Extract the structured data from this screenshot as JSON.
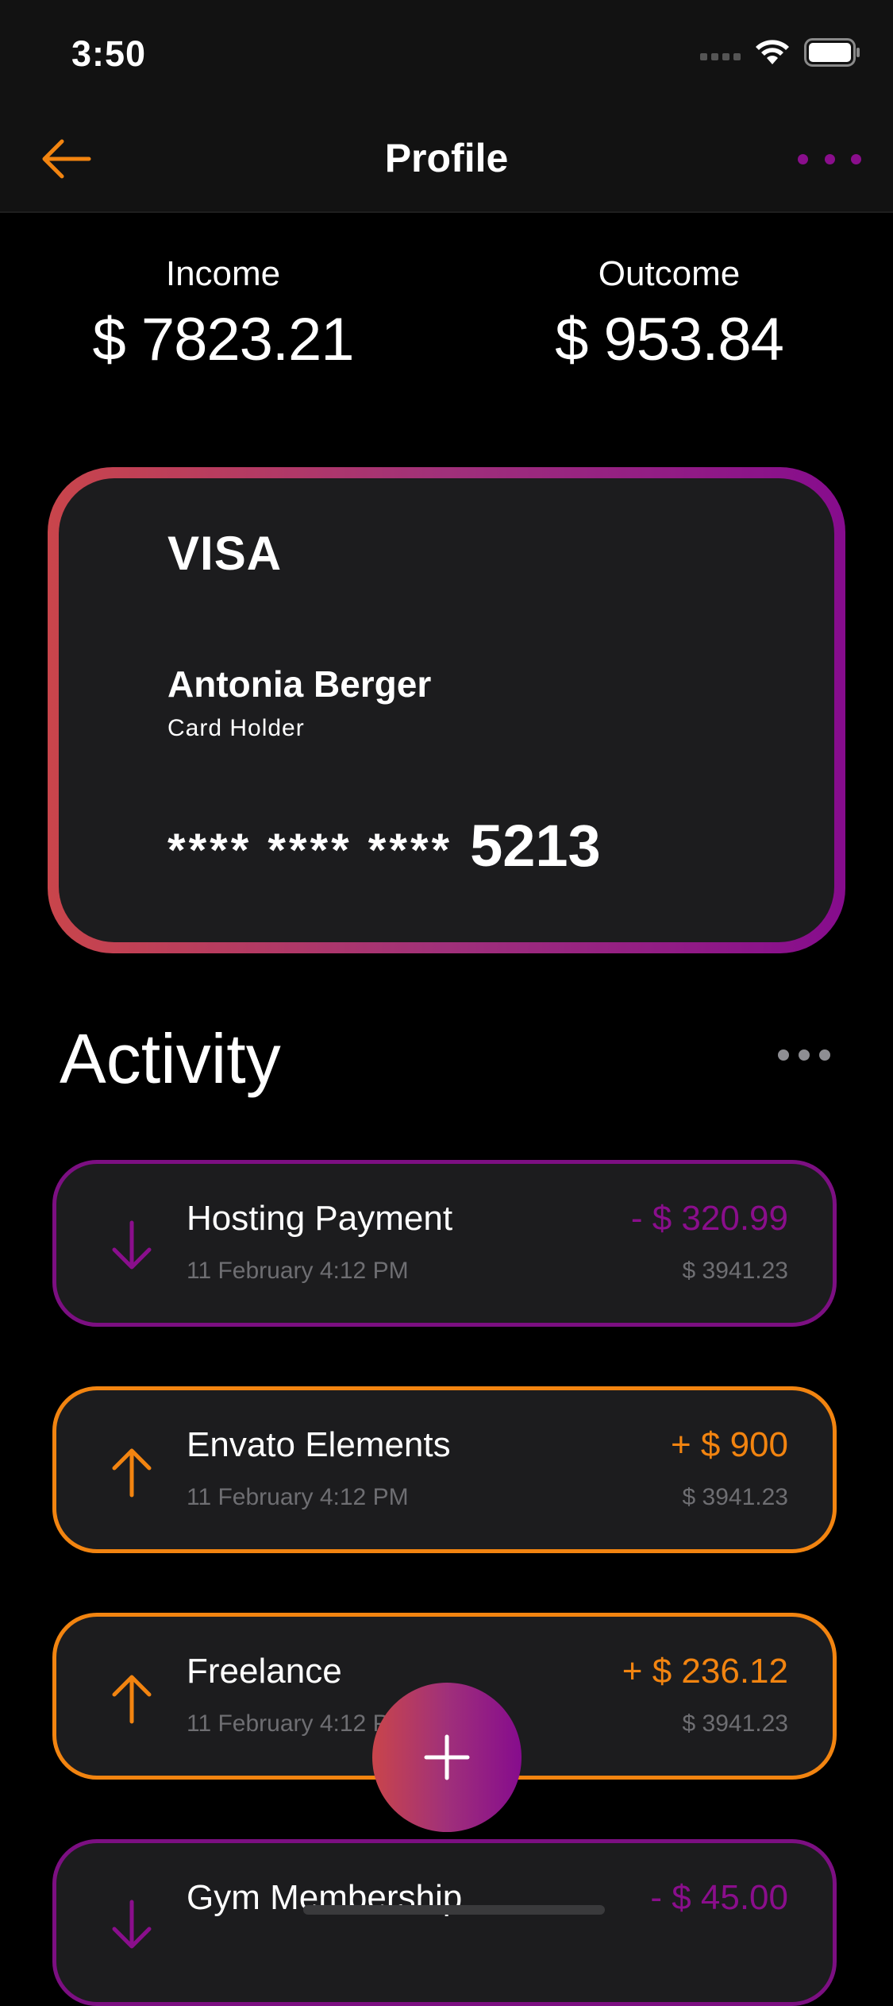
{
  "status_bar": {
    "time": "3:50"
  },
  "nav": {
    "title": "Profile"
  },
  "summary": {
    "income_label": "Income",
    "income_value": "$ 7823.21",
    "outcome_label": "Outcome",
    "outcome_value": "$ 953.84"
  },
  "card": {
    "brand": "VISA",
    "holder_name": "Antonia Berger",
    "holder_label": "Card Holder",
    "number_mask": "**** **** ****",
    "number_last": "5213"
  },
  "activity": {
    "title": "Activity",
    "items": [
      {
        "title": "Hosting Payment",
        "date": "11 February 4:12 PM",
        "amount": "- $ 320.99",
        "balance": "$ 3941.23",
        "direction": "out",
        "icon": "arrow-down-icon"
      },
      {
        "title": "Envato Elements",
        "date": "11 February 4:12 PM",
        "amount": "+ $ 900",
        "balance": "$ 3941.23",
        "direction": "in",
        "icon": "arrow-up-icon"
      },
      {
        "title": "Freelance",
        "date": "11 February 4:12 PM",
        "amount": "+ $ 236.12",
        "balance": "$ 3941.23",
        "direction": "in",
        "icon": "arrow-up-icon"
      },
      {
        "title": "Gym Membership",
        "date": "",
        "amount": "- $ 45.00",
        "balance": "",
        "direction": "out",
        "icon": "arrow-down-icon"
      }
    ]
  },
  "colors": {
    "background": "#000000",
    "surface": "#1c1c1e",
    "accent_orange": "#f28410",
    "accent_purple": "#8a0e8c",
    "gradient_start": "#c9454b",
    "gradient_end": "#860c8d",
    "muted_text": "#6e6e72"
  }
}
